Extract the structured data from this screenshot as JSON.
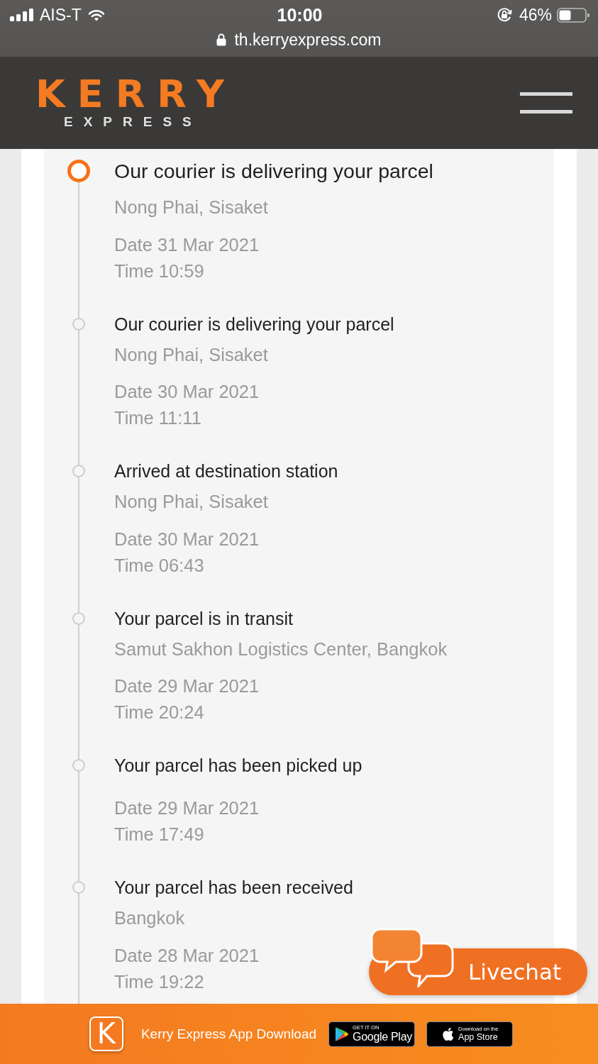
{
  "status_bar": {
    "carrier": "AIS-T",
    "time": "10:00",
    "battery": "46%",
    "url": "th.kerryexpress.com"
  },
  "header": {
    "logo": {
      "main": "KERRY",
      "sub": "EXPRESS"
    }
  },
  "timeline": [
    {
      "title": "Our courier is delivering your parcel",
      "location": "Nong Phai, Sisaket",
      "date": "Date 31 Mar 2021",
      "time": "Time 10:59",
      "current": true
    },
    {
      "title": "Our courier is delivering your parcel",
      "location": "Nong Phai, Sisaket",
      "date": "Date 30 Mar 2021",
      "time": "Time 11:11",
      "current": false
    },
    {
      "title": "Arrived at destination station",
      "location": "Nong Phai, Sisaket",
      "date": "Date 30 Mar 2021",
      "time": "Time 06:43",
      "current": false
    },
    {
      "title": "Your parcel is in transit",
      "location": "Samut Sakhon Logistics Center, Bangkok",
      "date": "Date 29 Mar 2021",
      "time": "Time 20:24",
      "current": false
    },
    {
      "title": "Your parcel has been picked up",
      "date": "Date 29 Mar 2021",
      "time": "Time 17:49",
      "current": false
    },
    {
      "title": "Your parcel has been received",
      "location": "Bangkok",
      "date": "Date 28 Mar 2021",
      "time": "Time 19:22",
      "current": false
    }
  ],
  "livechat": {
    "label": "Livechat"
  },
  "footer": {
    "app_logo": "K",
    "label": "Kerry Express App Download",
    "store_badges": [
      {
        "kind": "google-play",
        "caption": "GET IT ON",
        "name": "Google Play"
      },
      {
        "kind": "app-store",
        "caption": "Download on the",
        "name": "App Store"
      }
    ]
  }
}
